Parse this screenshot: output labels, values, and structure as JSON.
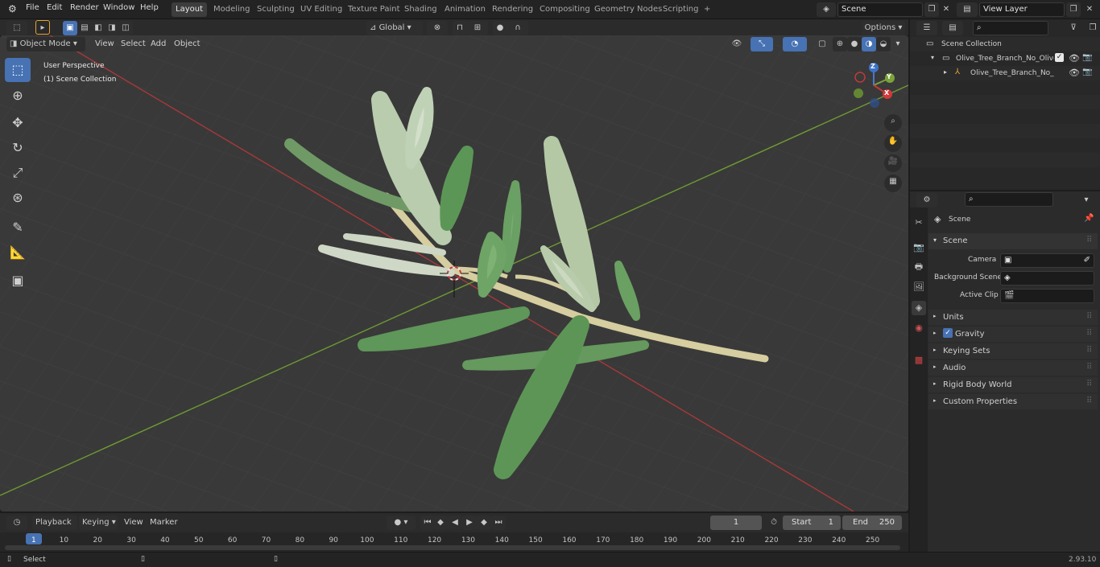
{
  "menu": {
    "file": "File",
    "edit": "Edit",
    "render": "Render",
    "window": "Window",
    "help": "Help"
  },
  "workspaces": [
    {
      "label": "Layout",
      "active": true
    },
    {
      "label": "Modeling"
    },
    {
      "label": "Sculpting"
    },
    {
      "label": "UV Editing"
    },
    {
      "label": "Texture Paint"
    },
    {
      "label": "Shading"
    },
    {
      "label": "Animation"
    },
    {
      "label": "Rendering"
    },
    {
      "label": "Compositing"
    },
    {
      "label": "Geometry Nodes"
    },
    {
      "label": "Scripting"
    },
    {
      "label": "+"
    }
  ],
  "scene_field": "Scene",
  "view_layer_field": "View Layer",
  "viewport_header": {
    "mode": "Object Mode",
    "view": "View",
    "select": "Select",
    "add": "Add",
    "object": "Object",
    "transform": "Global",
    "options": "Options"
  },
  "viewport_info": {
    "line1": "User Perspective",
    "line2": "(1) Scene Collection"
  },
  "gizmo": {
    "z": "Z",
    "y": "Y",
    "x": "X"
  },
  "outliner": {
    "search_placeholder": "",
    "root": "Scene Collection",
    "item1": "Olive_Tree_Branch_No_Olives",
    "item2": "Olive_Tree_Branch_No_C"
  },
  "properties": {
    "search_placeholder": "",
    "header": "Scene",
    "section": "Scene",
    "camera_label": "Camera",
    "bg_scene_label": "Background Scene",
    "active_clip_label": "Active Clip",
    "panels": [
      "Units",
      "Gravity",
      "Keying Sets",
      "Audio",
      "Rigid Body World",
      "Custom Properties"
    ],
    "gravity_checked": true
  },
  "timeline": {
    "playback": "Playback",
    "keying": "Keying",
    "view": "View",
    "marker": "Marker",
    "current_frame": "1",
    "start_label": "Start",
    "start_value": "1",
    "end_label": "End",
    "end_value": "250",
    "ticks": [
      "1",
      "10",
      "20",
      "30",
      "40",
      "50",
      "60",
      "70",
      "80",
      "90",
      "100",
      "110",
      "120",
      "130",
      "140",
      "150",
      "160",
      "170",
      "180",
      "190",
      "200",
      "210",
      "220",
      "230",
      "240",
      "250"
    ]
  },
  "status": {
    "select": "Select",
    "version": "2.93.10"
  },
  "colors": {
    "accent": "#4772b3",
    "x_axis": "#c0393b",
    "y_axis": "#7fb03a",
    "leaf": "#6fa06a",
    "stem": "#d8cf9e"
  }
}
